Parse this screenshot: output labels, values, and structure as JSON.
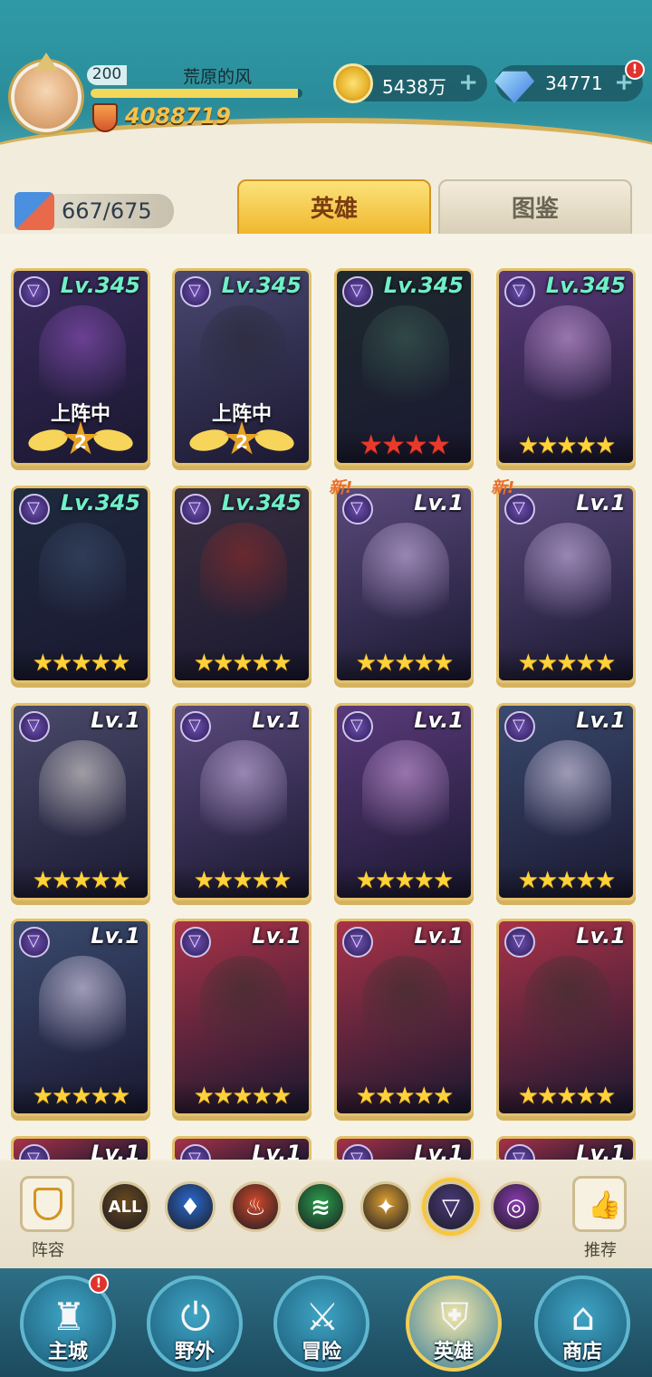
{
  "player": {
    "level": "200",
    "name": "荒原的风",
    "power": "4088719",
    "exp_fraction": 0.98
  },
  "resources": {
    "gold": "5438万",
    "gems": "34771",
    "gem_alert": "!"
  },
  "hero_count": "667/675",
  "tabs": {
    "heroes": "英雄",
    "codex": "图鉴"
  },
  "cards": [
    {
      "level": "Lv.345",
      "max": true,
      "stars": 2,
      "star_color": "rank",
      "deploy": "上阵中",
      "rank": "2",
      "portrait": "#8a4fb8",
      "bg": "#3a2b5c"
    },
    {
      "level": "Lv.345",
      "max": true,
      "stars": 2,
      "star_color": "rank",
      "deploy": "上阵中",
      "rank": "2",
      "portrait": "#2a2a3a",
      "bg": "#4a4870"
    },
    {
      "level": "Lv.345",
      "max": true,
      "stars": 4,
      "star_color": "red",
      "deploy": "",
      "rank": "",
      "portrait": "#3b5c56",
      "bg": "#1e2a2e"
    },
    {
      "level": "Lv.345",
      "max": true,
      "stars": 5,
      "star_color": "gold",
      "deploy": "",
      "rank": "",
      "portrait": "#c89bd8",
      "bg": "#5a3a7a"
    },
    {
      "level": "Lv.345",
      "max": true,
      "stars": 5,
      "star_color": "gold",
      "deploy": "",
      "rank": "",
      "portrait": "#3a4a68",
      "bg": "#1e2a3e"
    },
    {
      "level": "Lv.345",
      "max": true,
      "stars": 5,
      "star_color": "gold",
      "deploy": "",
      "rank": "",
      "portrait": "#8a2a2a",
      "bg": "#3a3040"
    },
    {
      "level": "Lv.1",
      "max": false,
      "stars": 5,
      "star_color": "gold",
      "deploy": "",
      "rank": "",
      "portrait": "#c8b0e0",
      "bg": "#5a4a7c",
      "new": "新!"
    },
    {
      "level": "Lv.1",
      "max": false,
      "stars": 5,
      "star_color": "gold",
      "deploy": "",
      "rank": "",
      "portrait": "#c8b0e0",
      "bg": "#5a4a7c",
      "new": "新!"
    },
    {
      "level": "Lv.1",
      "max": false,
      "stars": 5,
      "star_color": "gold",
      "deploy": "",
      "rank": "",
      "portrait": "#d9d4d0",
      "bg": "#4a4a6a"
    },
    {
      "level": "Lv.1",
      "max": false,
      "stars": 5,
      "star_color": "gold",
      "deploy": "",
      "rank": "",
      "portrait": "#c8b0e0",
      "bg": "#5a4a7c"
    },
    {
      "level": "Lv.1",
      "max": false,
      "stars": 5,
      "star_color": "gold",
      "deploy": "",
      "rank": "",
      "portrait": "#c89bd8",
      "bg": "#5a3a7a"
    },
    {
      "level": "Lv.1",
      "max": false,
      "stars": 5,
      "star_color": "gold",
      "deploy": "",
      "rank": "",
      "portrait": "#dcd0ea",
      "bg": "#3a4a6e"
    },
    {
      "level": "Lv.1",
      "max": false,
      "stars": 5,
      "star_color": "gold",
      "deploy": "",
      "rank": "",
      "portrait": "#dcd0ea",
      "bg": "#3a4a6e"
    },
    {
      "level": "Lv.1",
      "max": false,
      "stars": 5,
      "star_color": "gold",
      "deploy": "",
      "rank": "",
      "portrait": "#3a3030",
      "bg": "#a83248"
    },
    {
      "level": "Lv.1",
      "max": false,
      "stars": 5,
      "star_color": "gold",
      "deploy": "",
      "rank": "",
      "portrait": "#3a3030",
      "bg": "#a83248"
    },
    {
      "level": "Lv.1",
      "max": false,
      "stars": 5,
      "star_color": "gold",
      "deploy": "",
      "rank": "",
      "portrait": "#3a3030",
      "bg": "#a83248"
    },
    {
      "level": "Lv.1",
      "max": false,
      "stars": 0,
      "star_color": "gold",
      "deploy": "",
      "rank": "",
      "portrait": "#a83248",
      "bg": "#a83248"
    },
    {
      "level": "Lv.1",
      "max": false,
      "stars": 0,
      "star_color": "gold",
      "deploy": "",
      "rank": "",
      "portrait": "#a83248",
      "bg": "#a83248"
    },
    {
      "level": "Lv.1",
      "max": false,
      "stars": 0,
      "star_color": "gold",
      "deploy": "",
      "rank": "",
      "portrait": "#a83248",
      "bg": "#a83248"
    },
    {
      "level": "Lv.1",
      "max": false,
      "stars": 0,
      "star_color": "gold",
      "deploy": "",
      "rank": "",
      "portrait": "#a83248",
      "bg": "#a83248"
    }
  ],
  "filters": {
    "lineup_label": "阵容",
    "recommend_label": "推荐",
    "all_label": "ALL",
    "factions": [
      {
        "name": "all",
        "color": "#6a4a1e",
        "glyph": "ALL"
      },
      {
        "name": "water",
        "color": "#2a6ad0",
        "glyph": "♦"
      },
      {
        "name": "fire",
        "color": "#d0482a",
        "glyph": "♨"
      },
      {
        "name": "wind",
        "color": "#2aa04a",
        "glyph": "≋"
      },
      {
        "name": "light",
        "color": "#e0a030",
        "glyph": "✦"
      },
      {
        "name": "dark",
        "color": "#4a3a7a",
        "glyph": "▽"
      },
      {
        "name": "arcane",
        "color": "#8a3ab0",
        "glyph": "◎"
      }
    ]
  },
  "nav": [
    {
      "label": "主城",
      "icon": "castle-icon",
      "glyph": "♜",
      "badge": "!"
    },
    {
      "label": "野外",
      "icon": "portal-icon",
      "glyph": "⏻",
      "badge": ""
    },
    {
      "label": "冒险",
      "icon": "sword-icon",
      "glyph": "⚔",
      "badge": ""
    },
    {
      "label": "英雄",
      "icon": "helmet-icon",
      "glyph": "⛨",
      "badge": ""
    },
    {
      "label": "商店",
      "icon": "shop-icon",
      "glyph": "⌂",
      "badge": ""
    }
  ]
}
